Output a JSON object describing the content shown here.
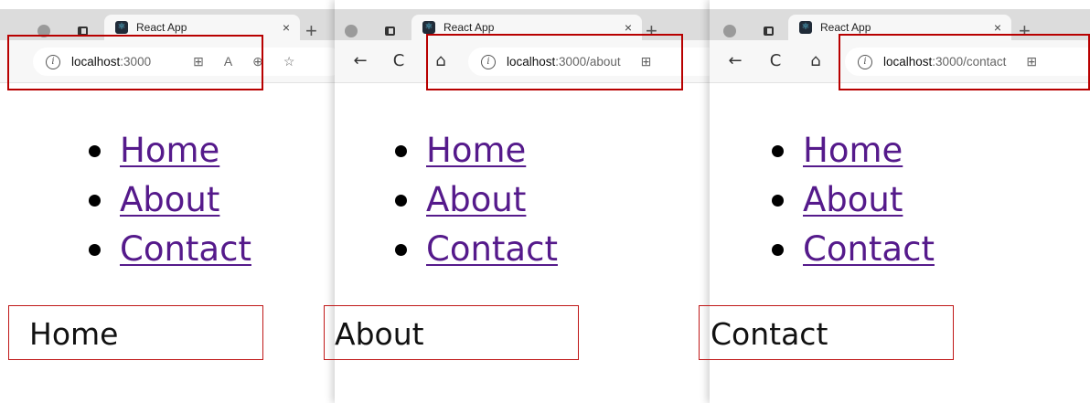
{
  "windows": [
    {
      "tab_title": "React App",
      "tab_close": "×",
      "new_tab": "+",
      "url_host": "localhost",
      "url_path": ":3000",
      "addr_extra": [
        "⊞",
        "A",
        "⊕",
        "☆"
      ],
      "nav": [
        "Home",
        "About",
        "Contact"
      ],
      "page_text": "Home"
    },
    {
      "tab_title": "React App",
      "tab_close": "×",
      "new_tab": "+",
      "url_host": "localhost",
      "url_path": ":3000/about",
      "addr_extra": [
        "⊞"
      ],
      "nav": [
        "Home",
        "About",
        "Contact"
      ],
      "page_text": "About"
    },
    {
      "tab_title": "React App",
      "tab_close": "×",
      "new_tab": "+",
      "url_host": "localhost",
      "url_path": ":3000/contact",
      "addr_extra": [
        "⊞"
      ],
      "nav": [
        "Home",
        "About",
        "Contact"
      ],
      "page_text": "Contact"
    }
  ],
  "icons": {
    "back": "←",
    "reload": "C",
    "home": "⌂",
    "info": "i"
  },
  "colors": {
    "link": "#551a8b",
    "highlight": "#b80000",
    "tabstrip": "#dcdcdc",
    "toolbar": "#f7f7f7"
  }
}
